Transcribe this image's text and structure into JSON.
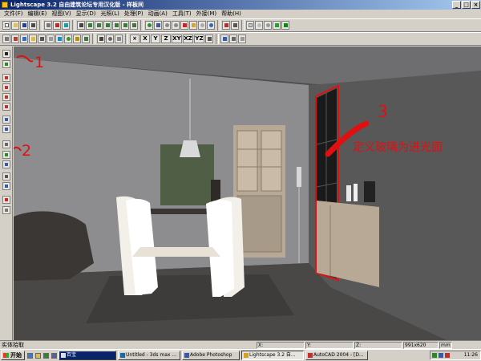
{
  "app": {
    "title": "Lightscape 3.2 自由建筑论坛专用汉化版 - 样板间",
    "window_buttons": [
      "_",
      "□",
      "×"
    ]
  },
  "menu": [
    "文件(F)",
    "编辑(E)",
    "视图(V)",
    "显示(D)",
    "光照(L)",
    "处理(P)",
    "动画(A)",
    "工具(T)",
    "外接(M)",
    "帮助(H)"
  ],
  "toolbar2": {
    "axis_labels": [
      "X",
      "Y",
      "Z",
      "XY",
      "XZ",
      "YZ"
    ]
  },
  "viewport": {
    "annotations": {
      "mark1": "1",
      "mark2": "2",
      "mark3": "3",
      "note": "定义玻璃为进光面"
    },
    "colors": {
      "annotation_red": "#e01010",
      "wall": "#8a8a8c",
      "floor": "#4e4c4a",
      "painting": "#4f5e45",
      "wood": "#b8a896"
    }
  },
  "status": {
    "message": "实体拾取",
    "x_label": "X:",
    "y_label": "Y:",
    "z_label": "Z:",
    "resolution": "991x620",
    "unit": "mm"
  },
  "taskbar": {
    "start": "开始",
    "tasks": [
      "百宝",
      "Untitled - 3ds max ...",
      "Adobe Photoshop",
      "Lightscape 3.2 自...",
      "AutoCAD 2004 - [D..."
    ],
    "clock": "11:26"
  }
}
